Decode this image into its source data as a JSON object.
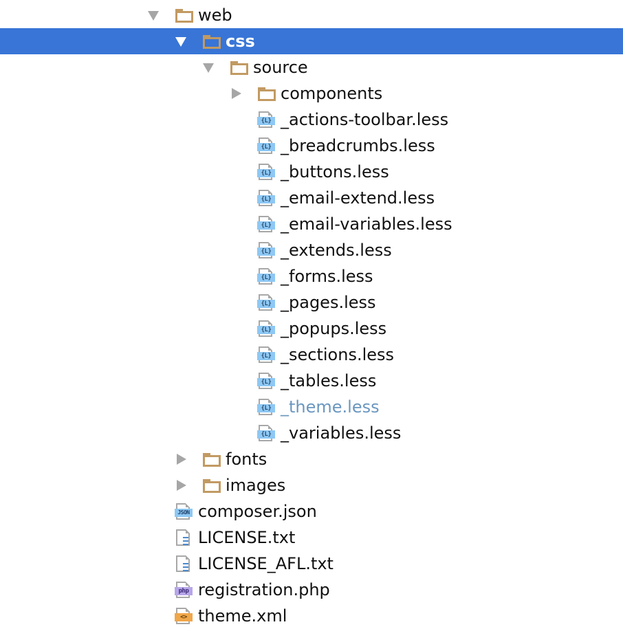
{
  "tree": {
    "colors": {
      "selection": "#3875d7",
      "folder": "#c29a62",
      "less_badge": "#8ec8f4",
      "php_badge": "#b7a6e8",
      "xml_badge": "#f0a64a",
      "modified_text": "#6a97c0"
    },
    "items": [
      {
        "label": "web",
        "type": "folder",
        "expanded": true,
        "depth": 0,
        "icon": "folder-icon"
      },
      {
        "label": "css",
        "type": "folder",
        "expanded": true,
        "depth": 1,
        "icon": "folder-icon",
        "selected": true
      },
      {
        "label": "source",
        "type": "folder",
        "expanded": true,
        "depth": 2,
        "icon": "folder-icon"
      },
      {
        "label": "components",
        "type": "folder",
        "expanded": false,
        "depth": 3,
        "icon": "folder-icon"
      },
      {
        "label": "_actions-toolbar.less",
        "type": "less",
        "depth": 3,
        "icon": "less-file-icon",
        "badge": "{L}"
      },
      {
        "label": "_breadcrumbs.less",
        "type": "less",
        "depth": 3,
        "icon": "less-file-icon",
        "badge": "{L}"
      },
      {
        "label": "_buttons.less",
        "type": "less",
        "depth": 3,
        "icon": "less-file-icon",
        "badge": "{L}"
      },
      {
        "label": "_email-extend.less",
        "type": "less",
        "depth": 3,
        "icon": "less-file-icon",
        "badge": "{L}"
      },
      {
        "label": "_email-variables.less",
        "type": "less",
        "depth": 3,
        "icon": "less-file-icon",
        "badge": "{L}"
      },
      {
        "label": "_extends.less",
        "type": "less",
        "depth": 3,
        "icon": "less-file-icon",
        "badge": "{L}"
      },
      {
        "label": "_forms.less",
        "type": "less",
        "depth": 3,
        "icon": "less-file-icon",
        "badge": "{L}"
      },
      {
        "label": "_pages.less",
        "type": "less",
        "depth": 3,
        "icon": "less-file-icon",
        "badge": "{L}"
      },
      {
        "label": "_popups.less",
        "type": "less",
        "depth": 3,
        "icon": "less-file-icon",
        "badge": "{L}"
      },
      {
        "label": "_sections.less",
        "type": "less",
        "depth": 3,
        "icon": "less-file-icon",
        "badge": "{L}"
      },
      {
        "label": "_tables.less",
        "type": "less",
        "depth": 3,
        "icon": "less-file-icon",
        "badge": "{L}"
      },
      {
        "label": "_theme.less",
        "type": "less",
        "depth": 3,
        "icon": "less-file-icon",
        "badge": "{L}",
        "modified": true
      },
      {
        "label": "_variables.less",
        "type": "less",
        "depth": 3,
        "icon": "less-file-icon",
        "badge": "{L}"
      },
      {
        "label": "fonts",
        "type": "folder",
        "expanded": false,
        "depth": 1,
        "icon": "folder-icon"
      },
      {
        "label": "images",
        "type": "folder",
        "expanded": false,
        "depth": 1,
        "icon": "folder-icon"
      },
      {
        "label": "composer.json",
        "type": "json",
        "depth": 0,
        "icon": "json-file-icon",
        "badge": "JSON"
      },
      {
        "label": "LICENSE.txt",
        "type": "txt",
        "depth": 0,
        "icon": "text-file-icon"
      },
      {
        "label": "LICENSE_AFL.txt",
        "type": "txt",
        "depth": 0,
        "icon": "text-file-icon"
      },
      {
        "label": "registration.php",
        "type": "php",
        "depth": 0,
        "icon": "php-file-icon",
        "badge": "php"
      },
      {
        "label": "theme.xml",
        "type": "xml",
        "depth": 0,
        "icon": "xml-file-icon",
        "badge": "<>"
      }
    ]
  }
}
